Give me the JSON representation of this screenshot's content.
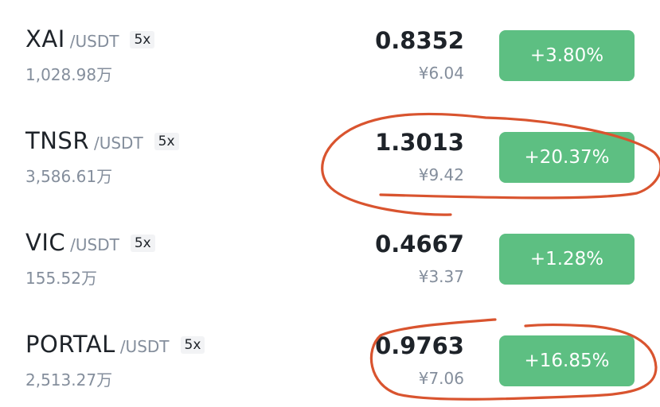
{
  "market_list": [
    {
      "base": "XAI",
      "quote": "/USDT",
      "leverage": "5x",
      "volume": "1,028.98万",
      "price": "0.8352",
      "fiat": "¥6.04",
      "change": "+3.80%"
    },
    {
      "base": "TNSR",
      "quote": "/USDT",
      "leverage": "5x",
      "volume": "3,586.61万",
      "price": "1.3013",
      "fiat": "¥9.42",
      "change": "+20.37%"
    },
    {
      "base": "VIC",
      "quote": "/USDT",
      "leverage": "5x",
      "volume": "155.52万",
      "price": "0.4667",
      "fiat": "¥3.37",
      "change": "+1.28%"
    },
    {
      "base": "PORTAL",
      "quote": "/USDT",
      "leverage": "5x",
      "volume": "2,513.27万",
      "price": "0.9763",
      "fiat": "¥7.06",
      "change": "+16.85%"
    }
  ],
  "colors": {
    "up": "#5dbf82",
    "annotation": "#d9542f",
    "text_primary": "#1e2329",
    "text_secondary": "#848e9c"
  }
}
